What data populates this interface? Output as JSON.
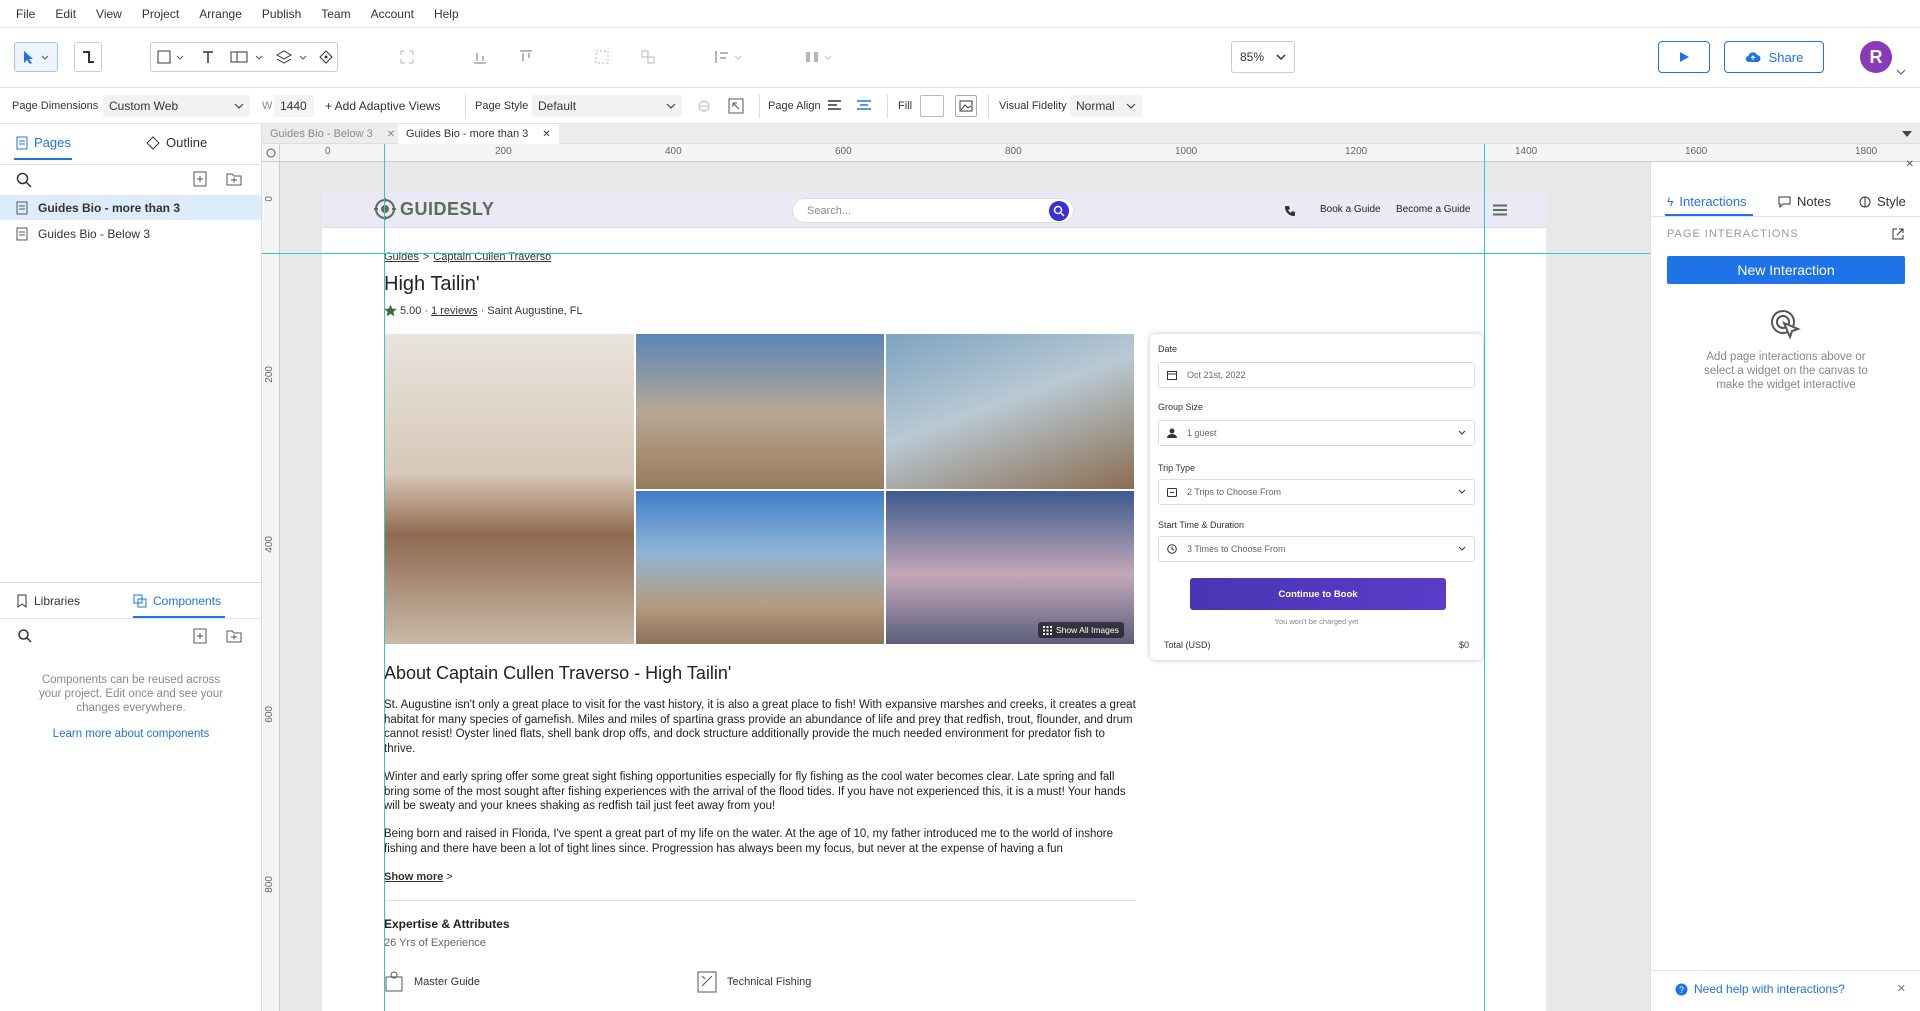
{
  "menu": [
    "File",
    "Edit",
    "View",
    "Project",
    "Arrange",
    "Publish",
    "Team",
    "Account",
    "Help"
  ],
  "toolbar": {
    "zoom": "85%",
    "share_label": "Share",
    "avatar_initial": "R"
  },
  "propbar": {
    "page_dimensions_label": "Page Dimensions",
    "page_dimensions_value": "Custom Web",
    "width_label": "W",
    "width_value": "1440",
    "add_adaptive_label": "+ Add Adaptive Views",
    "page_style_label": "Page Style",
    "page_style_value": "Default",
    "page_align_label": "Page Align",
    "fill_label": "Fill",
    "fidelity_label": "Visual Fidelity",
    "fidelity_value": "Normal"
  },
  "left": {
    "tabs": {
      "pages": "Pages",
      "outline": "Outline"
    },
    "pages": [
      "Guides Bio - more than 3",
      "Guides Bio - Below 3"
    ],
    "bottom_tabs": {
      "libraries": "Libraries",
      "components": "Components"
    },
    "components_info": "Components can be reused across your project. Edit once and see your changes everywhere.",
    "components_link": "Learn more about components"
  },
  "doc_tabs": [
    "Guides Bio - Below 3",
    "Guides Bio - more than 3"
  ],
  "ruler": {
    "h": [
      "0",
      "200",
      "400",
      "600",
      "800",
      "1000",
      "1200",
      "1400",
      "1600",
      "1800"
    ],
    "v": [
      "0",
      "200",
      "400",
      "600",
      "800"
    ]
  },
  "right": {
    "tabs": {
      "interactions": "Interactions",
      "notes": "Notes",
      "style": "Style"
    },
    "heading": "PAGE INTERACTIONS",
    "new_interaction": "New Interaction",
    "hint": "Add page interactions above or select a widget on the canvas to make the widget interactive",
    "help": "Need help with interactions?"
  },
  "site": {
    "logo": "GUIDESLY",
    "search_placeholder": "Search...",
    "nav": [
      "Book a Guide",
      "Become a Guide"
    ],
    "breadcrumb": {
      "root": "Guides",
      "sep": ">",
      "current": "Captain Cullen Traverso"
    },
    "title": "High Tailin'",
    "rating": "5.00",
    "reviews": "1 reviews",
    "location": "Saint Augustine, FL",
    "show_all_images": "Show All Images",
    "about_title": "About Captain Cullen Traverso - High Tailin'",
    "paragraphs": [
      "St. Augustine isn't only a great place to visit for the vast history, it is also a great place to fish! With expansive marshes and creeks, it creates a great habitat for many species of gamefish. Miles and miles of spartina grass provide an abundance of life and prey that redfish, trout, flounder, and drum cannot resist! Oyster lined flats, shell bank drop offs, and dock structure additionally provide the much needed environment for predator fish to thrive.",
      "Winter and early spring offer some great sight fishing opportunities especially for fly fishing as the cool water becomes clear. Late spring and fall bring some of the most sought after fishing experiences with the arrival of the flood tides. If you have not experienced this, it is a must! Your hands will be sweaty and your knees shaking as redfish tail just feet away from you!",
      "Being born and raised in Florida, I've spent a great part of my life on the water. At the age of 10, my father introduced me to the world of inshore fishing and there have been a lot of tight lines since. Progression has always been my focus, but never at the expense of having a fun"
    ],
    "show_more": "Show more",
    "expertise_title": "Expertise & Attributes",
    "experience": "26 Yrs of Experience",
    "attributes": [
      "Master Guide",
      "Technical Fishing"
    ],
    "booking": {
      "date_label": "Date",
      "date_value": "Oct 21st, 2022",
      "group_label": "Group Size",
      "group_value": "1 guest",
      "trip_label": "Trip Type",
      "trip_value": "2 Trips to Choose From",
      "time_label": "Start Time & Duration",
      "time_value": "3 Times to Choose From",
      "cta": "Continue to Book",
      "note": "You won't be charged yet",
      "total_label": "Total (USD)",
      "total_value": "$0"
    }
  },
  "colors": {
    "accent": "#1e73e8",
    "cta": "#4a35b4",
    "header_bg": "#ece9f6",
    "guide_line": "#33c9c3"
  }
}
